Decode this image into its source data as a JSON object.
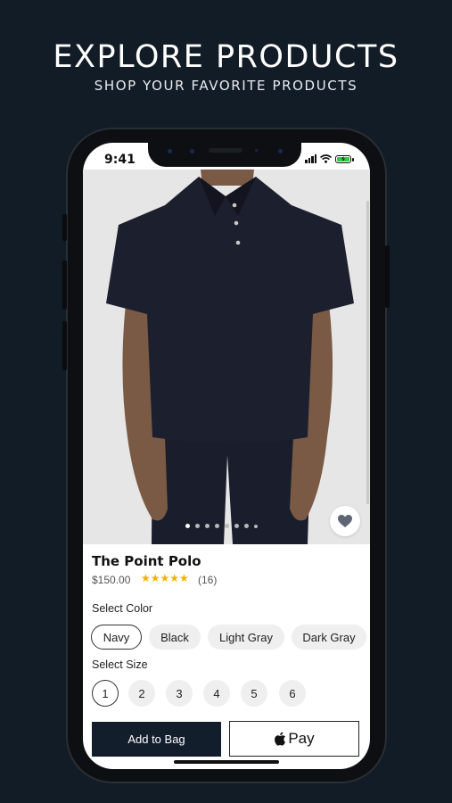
{
  "header": {
    "title": "EXPLORE PRODUCTS",
    "subtitle": "SHOP YOUR FAVORITE PRODUCTS"
  },
  "status_bar": {
    "time": "9:41",
    "icons": [
      "signal-icon",
      "wifi-icon",
      "battery-charging-icon"
    ]
  },
  "gallery": {
    "image": "navy polo shirt product photo",
    "page_count": 8,
    "active_page": 1,
    "favorite_icon": "heart-icon"
  },
  "product": {
    "name": "The Point Polo",
    "price": "$150.00",
    "rating": 5,
    "stars": "★★★★★",
    "review_count": "(16)"
  },
  "color_selector": {
    "label": "Select Color",
    "options": [
      "Navy",
      "Black",
      "Light Gray",
      "Dark Gray"
    ],
    "selected": "Navy"
  },
  "size_selector": {
    "label": "Select Size",
    "options": [
      "1",
      "2",
      "3",
      "4",
      "5",
      "6"
    ],
    "selected": "1"
  },
  "actions": {
    "add_to_bag": "Add to Bag",
    "apple_pay": "Pay",
    "apple_pay_icon": "apple-icon"
  },
  "colors": {
    "background": "#121c27",
    "primary_button": "#131e2c",
    "star": "#f2b200"
  }
}
